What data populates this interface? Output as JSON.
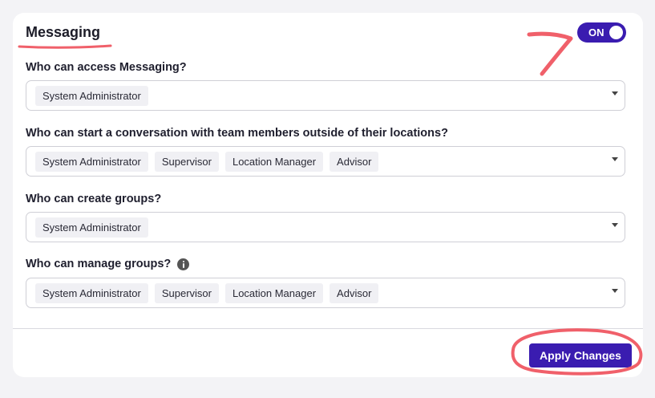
{
  "section": {
    "title": "Messaging",
    "toggle_label": "ON",
    "toggle_on": true
  },
  "questions": [
    {
      "label": "Who can access Messaging?",
      "selected": [
        "System Administrator"
      ],
      "has_info": false
    },
    {
      "label": "Who can start a conversation with team members outside of their locations?",
      "selected": [
        "System Administrator",
        "Supervisor",
        "Location Manager",
        "Advisor"
      ],
      "has_info": false
    },
    {
      "label": "Who can create groups?",
      "selected": [
        "System Administrator"
      ],
      "has_info": false
    },
    {
      "label": "Who can manage groups?",
      "selected": [
        "System Administrator",
        "Supervisor",
        "Location Manager",
        "Advisor"
      ],
      "has_info": true
    }
  ],
  "footer": {
    "apply_label": "Apply Changes"
  },
  "colors": {
    "accent": "#3a1cb0",
    "annotation": "#f0606a"
  }
}
